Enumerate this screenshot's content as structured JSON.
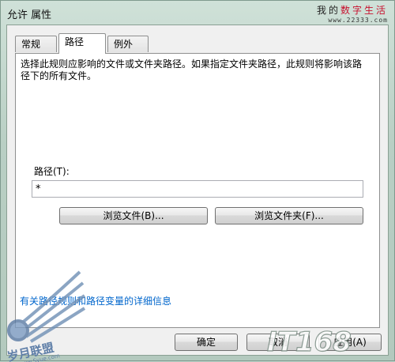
{
  "window": {
    "title": "允许 属性"
  },
  "watermark_top": {
    "part1": "我的",
    "part2": "数字",
    "part3": "生活",
    "url": "www.22333.com"
  },
  "tabs": [
    {
      "label": "常规",
      "active": false
    },
    {
      "label": "路径",
      "active": true
    },
    {
      "label": "例外",
      "active": false
    }
  ],
  "path_tab": {
    "description": "选择此规则应影响的文件或文件夹路径。如果指定文件夹路径，此规则将影响该路径下的所有文件。",
    "path_label": "路径(T):",
    "path_value": "*",
    "browse_file_label": "浏览文件(B)...",
    "browse_folder_label": "浏览文件夹(F)..."
  },
  "help_link": "有关路径规则和路径变量的详细信息",
  "footer": {
    "ok_label": "确定",
    "cancel_label": "取消",
    "apply_label": "应用(A)"
  },
  "watermark_bottom_left": {
    "brand": "岁月联盟",
    "url": "www.Syue.com"
  },
  "watermark_bottom_right": {
    "brand": "IT168"
  },
  "colors": {
    "link": "#0066cc",
    "frame": "#b9cfc4",
    "watermark_red": "#c8102e"
  }
}
